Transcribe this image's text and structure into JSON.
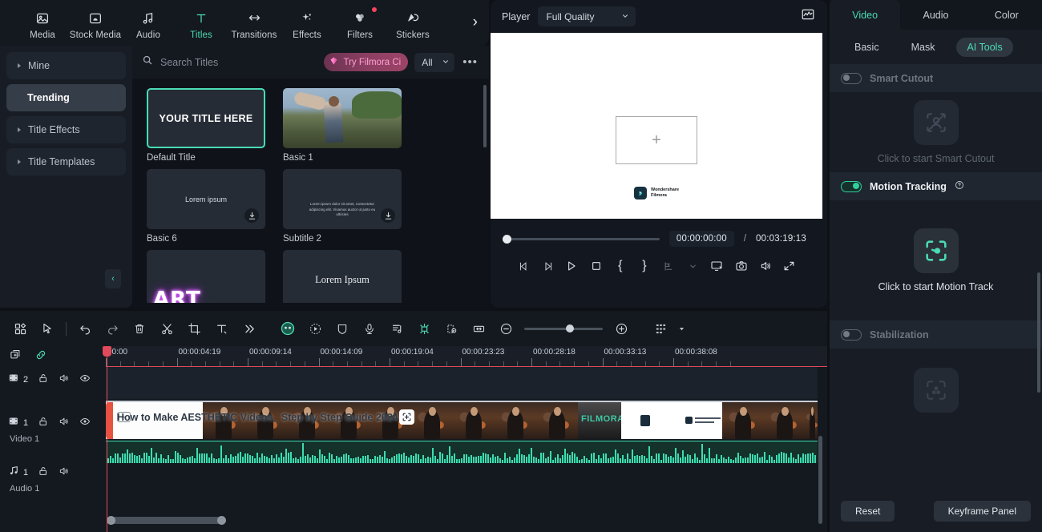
{
  "topnav": {
    "items": [
      {
        "label": "Media",
        "icon": "media-icon",
        "active": false,
        "dot": false
      },
      {
        "label": "Stock Media",
        "icon": "stock-media-icon",
        "active": false,
        "dot": false
      },
      {
        "label": "Audio",
        "icon": "audio-icon",
        "active": false,
        "dot": false
      },
      {
        "label": "Titles",
        "icon": "titles-icon",
        "active": true,
        "dot": false
      },
      {
        "label": "Transitions",
        "icon": "transitions-icon",
        "active": false,
        "dot": false
      },
      {
        "label": "Effects",
        "icon": "effects-icon",
        "active": false,
        "dot": false
      },
      {
        "label": "Filters",
        "icon": "filters-icon",
        "active": false,
        "dot": true
      },
      {
        "label": "Stickers",
        "icon": "stickers-icon",
        "active": false,
        "dot": false
      }
    ],
    "expand_arrow": "›"
  },
  "sidebar": {
    "items": [
      {
        "label": "Mine",
        "expandable": true,
        "active": false
      },
      {
        "label": "Trending",
        "expandable": false,
        "active": true
      },
      {
        "label": "Title Effects",
        "expandable": true,
        "active": false
      },
      {
        "label": "Title Templates",
        "expandable": true,
        "active": false
      }
    ],
    "collapse_label": "‹"
  },
  "browser": {
    "search_placeholder": "Search Titles",
    "try_button": "Try Filmora Ci",
    "filter_value": "All",
    "more_label": "•••",
    "tiles": [
      {
        "caption": "Default Title",
        "preview_text": "YOUR TITLE HERE",
        "style": "default",
        "selected": true,
        "download": false
      },
      {
        "caption": "Basic 1",
        "preview_text": "",
        "style": "photo",
        "selected": false,
        "download": false
      },
      {
        "caption": "Basic 6",
        "preview_text": "Lorem ipsum",
        "style": "plain",
        "selected": false,
        "download": true
      },
      {
        "caption": "Subtitle 2",
        "preview_text": "Lorem ipsum dolor sit amet, consectetur adipiscing elit. Vivamus auctor ut justo eu ultricies",
        "style": "subtitle",
        "selected": false,
        "download": true
      },
      {
        "caption": "",
        "preview_text": "ART",
        "style": "neon",
        "selected": false,
        "download": false
      },
      {
        "caption": "",
        "preview_text": "Lorem Ipsum",
        "style": "serif",
        "selected": false,
        "download": true
      }
    ]
  },
  "player": {
    "title": "Player",
    "quality": "Full Quality",
    "quality_caret": "˅",
    "scope_icon": "waveform-scope-icon",
    "canvas": {
      "placeholder_icon": "add-media-plus-icon",
      "watermark_brand": "Wondershare",
      "watermark_product": "Filmora"
    },
    "current_time": "00:00:00:00",
    "separator": "/",
    "total_time": "00:03:19:13",
    "controls": [
      {
        "name": "previous-frame-button",
        "glyph": "prev-frame"
      },
      {
        "name": "next-frame-button",
        "glyph": "next-frame"
      },
      {
        "name": "play-button",
        "glyph": "play"
      },
      {
        "name": "stop-button",
        "glyph": "stop"
      },
      {
        "name": "mark-in-button",
        "glyph": "{"
      },
      {
        "name": "mark-out-button",
        "glyph": "}"
      },
      {
        "name": "markers-button",
        "glyph": "marker"
      },
      {
        "name": "markers-dropdown",
        "glyph": "caret"
      },
      {
        "name": "display-settings-button",
        "glyph": "display"
      },
      {
        "name": "snapshot-button",
        "glyph": "camera"
      },
      {
        "name": "volume-button",
        "glyph": "speaker"
      },
      {
        "name": "fullscreen-button",
        "glyph": "expand"
      }
    ]
  },
  "rightpanel": {
    "tabs": [
      {
        "label": "Video",
        "active": true
      },
      {
        "label": "Audio",
        "active": false
      },
      {
        "label": "Color",
        "active": false
      }
    ],
    "subtabs": [
      {
        "label": "Basic",
        "active": false
      },
      {
        "label": "Mask",
        "active": false
      },
      {
        "label": "AI Tools",
        "active": true
      }
    ],
    "sections": [
      {
        "label": "Smart Cutout",
        "enabled": false,
        "has_help": false,
        "cta": "Click to start Smart Cutout",
        "icon": "smart-cutout-icon"
      },
      {
        "label": "Motion Tracking",
        "enabled": true,
        "has_help": true,
        "cta": "Click to start Motion Track",
        "icon": "motion-tracking-icon"
      },
      {
        "label": "Stabilization",
        "enabled": false,
        "has_help": false,
        "cta": "",
        "icon": "stabilization-icon"
      }
    ],
    "reset_label": "Reset",
    "keyframe_label": "Keyframe Panel"
  },
  "timeline": {
    "toolbar": [
      {
        "name": "layout-button",
        "glyph": "grid"
      },
      {
        "name": "select-tool-button",
        "glyph": "cursor"
      },
      {
        "name": "divider",
        "glyph": "div"
      },
      {
        "name": "undo-button",
        "glyph": "undo"
      },
      {
        "name": "redo-button",
        "glyph": "redo"
      },
      {
        "name": "delete-button",
        "glyph": "trash"
      },
      {
        "name": "split-button",
        "glyph": "scissors"
      },
      {
        "name": "crop-button",
        "glyph": "crop"
      },
      {
        "name": "text-button",
        "glyph": "text"
      },
      {
        "name": "more-tools-button",
        "glyph": "chevrons"
      },
      {
        "name": "ai-mask-button",
        "glyph": "circle-green"
      },
      {
        "name": "speed-ramping-button",
        "glyph": "speed"
      },
      {
        "name": "green-screen-button",
        "glyph": "shield"
      },
      {
        "name": "voiceover-button",
        "glyph": "mic"
      },
      {
        "name": "audio-detach-button",
        "glyph": "audio-note"
      },
      {
        "name": "auto-highlight-button",
        "glyph": "sparkle-green"
      },
      {
        "name": "auto-reframe-button",
        "glyph": "reframe"
      },
      {
        "name": "fit-timeline-button",
        "glyph": "fit"
      },
      {
        "name": "zoom-out-button",
        "glyph": "minus"
      },
      {
        "name": "zoom-slider",
        "glyph": "slider"
      },
      {
        "name": "zoom-in-button",
        "glyph": "plus"
      },
      {
        "name": "track-manager-button",
        "glyph": "tracks"
      },
      {
        "name": "track-manager-caret",
        "glyph": "caret"
      }
    ],
    "ruler_ticks": [
      "00:00",
      "00:00:04:19",
      "00:00:09:14",
      "00:00:14:09",
      "00:00:19:04",
      "00:00:23:23",
      "00:00:28:18",
      "00:00:33:13",
      "00:00:38:08"
    ],
    "tracks": [
      {
        "type": "video",
        "number": "2",
        "name": "",
        "locked": false,
        "muted": false,
        "visible": true
      },
      {
        "type": "video",
        "number": "1",
        "name": "Video 1",
        "locked": false,
        "muted": false,
        "visible": true
      },
      {
        "type": "audio",
        "number": "1",
        "name": "Audio 1",
        "locked": false,
        "muted": false,
        "visible": false
      }
    ],
    "clip_title": "How to Make AESTHETIC Videos_ Step by Step Guide 2024",
    "clip_filmora_text": "FILMORA"
  }
}
